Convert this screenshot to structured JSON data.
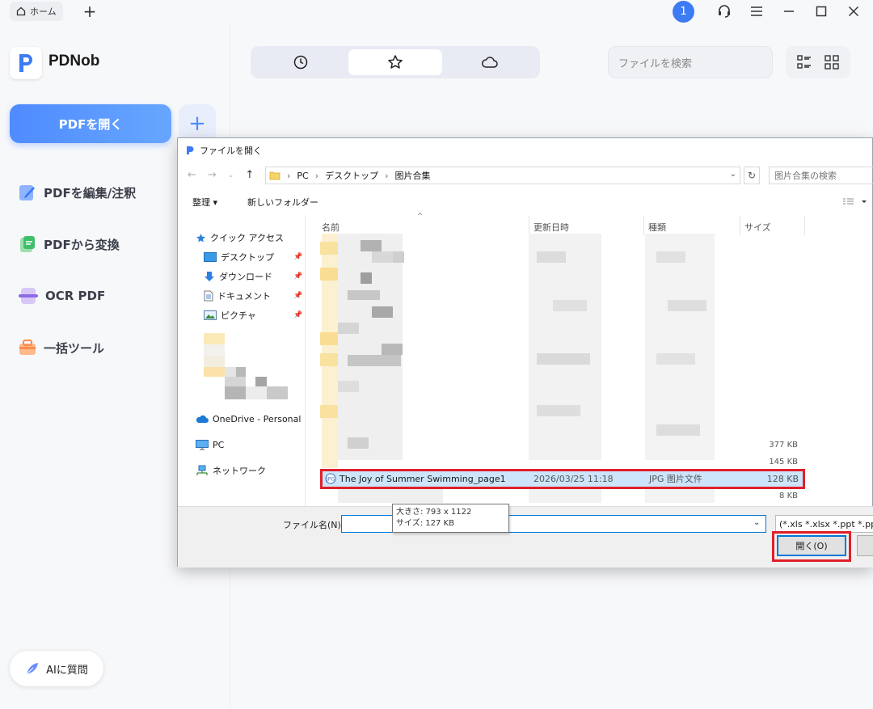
{
  "titlebar": {
    "home_tab": "ホーム",
    "notification_count": "1"
  },
  "sidebar": {
    "brand": "PDNob",
    "open_pdf": "PDFを開く",
    "nav": [
      {
        "label": "PDFを編集/注釈",
        "icon": "edit-icon"
      },
      {
        "label": "PDFから変換",
        "icon": "convert-icon"
      },
      {
        "label": "OCR PDF",
        "icon": "ocr-icon"
      },
      {
        "label": "一括ツール",
        "icon": "batch-tools-icon"
      }
    ],
    "ai_button": "AIに質問"
  },
  "main": {
    "search_placeholder": "ファイルを検索"
  },
  "dialog": {
    "title": "ファイルを開く",
    "breadcrumb": [
      "PC",
      "デスクトップ",
      "图片合集"
    ],
    "search_placeholder": "图片合集の検索",
    "organize": "整理 ▾",
    "new_folder": "新しいフォルダー",
    "tree": {
      "quick_access": "クイック アクセス",
      "desktop": "デスクトップ",
      "downloads": "ダウンロード",
      "documents": "ドキュメント",
      "pictures": "ピクチャ",
      "onedrive": "OneDrive - Personal",
      "pc": "PC",
      "network": "ネットワーク"
    },
    "columns": {
      "name": "名前",
      "modified": "更新日時",
      "type": "種類",
      "size": "サイズ"
    },
    "visible_sizes": [
      "377 KB",
      "145 KB",
      "8 KB"
    ],
    "selected_file": {
      "name": "The Joy of Summer Swimming_page1",
      "modified": "2026/03/25 11:18",
      "type": "JPG 图片文件",
      "size": "128 KB"
    },
    "tooltip": {
      "dimensions": "大きさ: 793 x 1122",
      "size": "サイズ: 127 KB"
    },
    "filename_label": "ファイル名(N):",
    "filename_value": "",
    "filter": "(*.xls *.xlsx *.ppt *.pptx",
    "open_button": "開く(O)"
  },
  "colors": {
    "accent": "#4f8bff",
    "highlight_box": "#e0202a",
    "selection": "#cce5fb"
  }
}
